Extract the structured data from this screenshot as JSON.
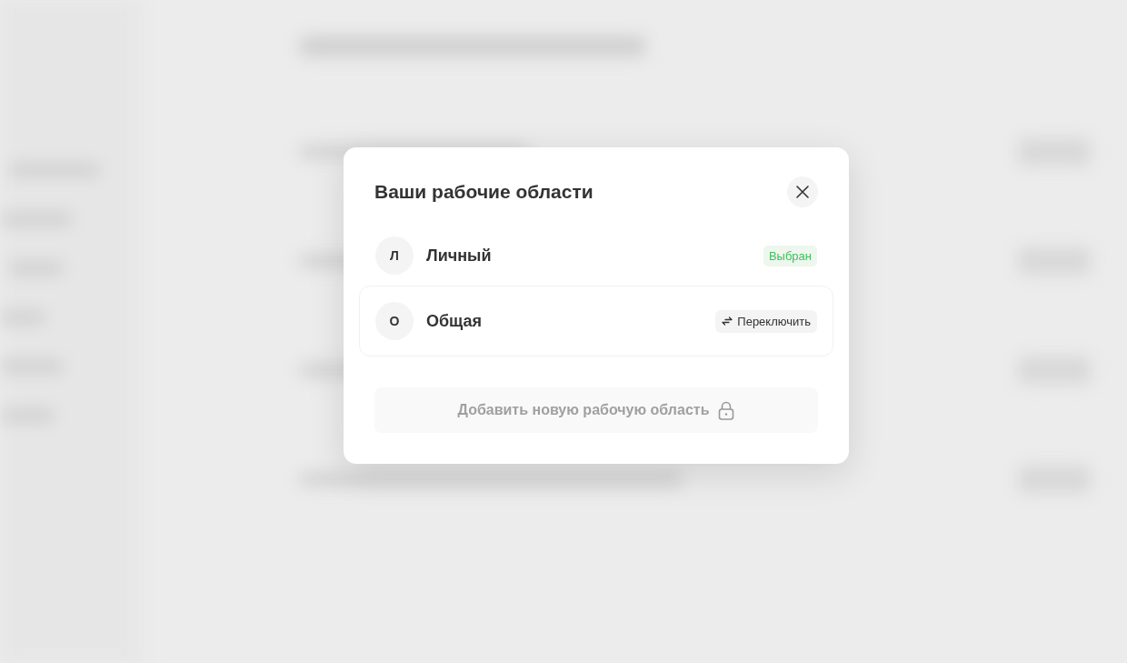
{
  "dialog": {
    "title": "Ваши рабочие области",
    "workspaces": [
      {
        "initial": "Л",
        "name": "Личный",
        "selected": true,
        "status": "Выбран"
      },
      {
        "initial": "О",
        "name": "Общая",
        "selected": false,
        "action": "Переключить"
      }
    ],
    "add_button": {
      "label": "Добавить новую рабочую область",
      "disabled": true
    }
  }
}
